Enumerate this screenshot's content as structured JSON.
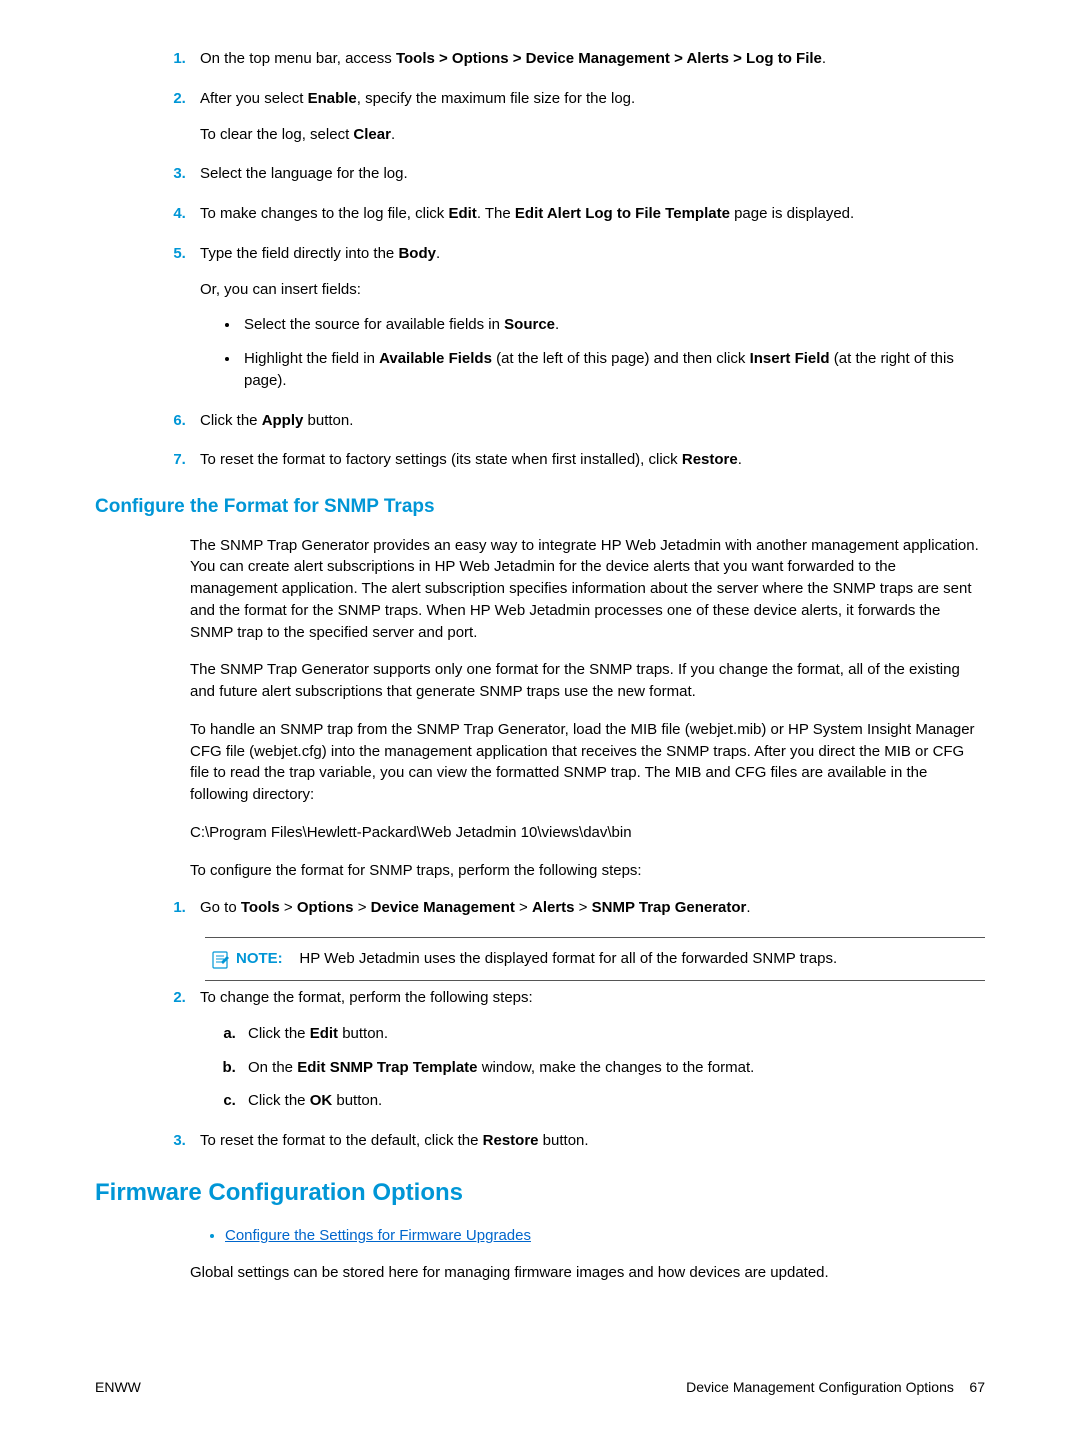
{
  "steps_top": [
    {
      "pre": "On the top menu bar, access ",
      "b1": "Tools > Options > Device Management > Alerts > Log to File",
      "post": "."
    },
    {
      "pre": "After you select ",
      "b1": "Enable",
      "mid": ", specify the maximum file size for the log.",
      "sub_pre": "To clear the log, select ",
      "sub_b": "Clear",
      "sub_post": "."
    },
    {
      "text": "Select the language for the log."
    },
    {
      "pre": "To make changes to the log file, click ",
      "b1": "Edit",
      "mid": ". The ",
      "b2": "Edit Alert Log to File Template",
      "post": " page is displayed."
    },
    {
      "pre": "Type the field directly into the ",
      "b1": "Body",
      "post": ".",
      "sub_plain": "Or, you can insert fields:",
      "bullets": [
        {
          "pre": "Select the source for available fields in ",
          "b1": "Source",
          "post": "."
        },
        {
          "pre": "Highlight the field in ",
          "b1": "Available Fields",
          "mid": " (at the left of this page) and then click ",
          "b2": "Insert Field",
          "post": " (at the right of this page)."
        }
      ]
    },
    {
      "pre": "Click the ",
      "b1": "Apply",
      "post": " button."
    },
    {
      "pre": "To reset the format to factory settings (its state when first installed), click ",
      "b1": "Restore",
      "post": "."
    }
  ],
  "h2_snmp": "Configure the Format for SNMP Traps",
  "snmp_p1": "The SNMP Trap Generator provides an easy way to integrate HP Web Jetadmin with another management application. You can create alert subscriptions in HP Web Jetadmin for the device alerts that you want forwarded to the management application. The alert subscription specifies information about the server where the SNMP traps are sent and the format for the SNMP traps. When HP Web Jetadmin processes one of these device alerts, it forwards the SNMP trap to the specified server and port.",
  "snmp_p2": "The SNMP Trap Generator supports only one format for the SNMP traps. If you change the format, all of the existing and future alert subscriptions that generate SNMP traps use the new format.",
  "snmp_p3": "To handle an SNMP trap from the SNMP Trap Generator, load the MIB file (webjet.mib) or HP System Insight Manager CFG file (webjet.cfg) into the management application that receives the SNMP traps. After you direct the MIB or CFG file to read the trap variable, you can view the formatted SNMP trap. The MIB and CFG files are available in the following directory:",
  "snmp_path": "C:\\Program Files\\Hewlett-Packard\\Web Jetadmin 10\\views\\dav\\bin",
  "snmp_p4": "To configure the format for SNMP traps, perform the following steps:",
  "snmp_steps": {
    "s1_pre": "Go to ",
    "s1_b1": "Tools",
    "s1_gt1": " > ",
    "s1_b2": "Options",
    "s1_gt2": " > ",
    "s1_b3": "Device Management",
    "s1_gt3": " > ",
    "s1_b4": "Alerts",
    "s1_gt4": " > ",
    "s1_b5": "SNMP Trap Generator",
    "s1_post": ".",
    "note_label": "NOTE:",
    "note_text": "HP Web Jetadmin uses the displayed format for all of the forwarded SNMP traps.",
    "s2_text": "To change the format, perform the following steps:",
    "s2a_pre": "Click the ",
    "s2a_b": "Edit",
    "s2a_post": " button.",
    "s2b_pre": "On the ",
    "s2b_b": "Edit SNMP Trap Template",
    "s2b_post": " window, make the changes to the format.",
    "s2c_pre": "Click the ",
    "s2c_b": "OK",
    "s2c_post": " button.",
    "s3_pre": "To reset the format to the default, click the ",
    "s3_b": "Restore",
    "s3_post": " button."
  },
  "h1_firmware": "Firmware Configuration Options",
  "firmware_link": "Configure the Settings for Firmware Upgrades",
  "firmware_p": "Global settings can be stored here for managing firmware images and how devices are updated.",
  "footer_left": "ENWW",
  "footer_right_text": "Device Management Configuration Options",
  "footer_page": "67"
}
